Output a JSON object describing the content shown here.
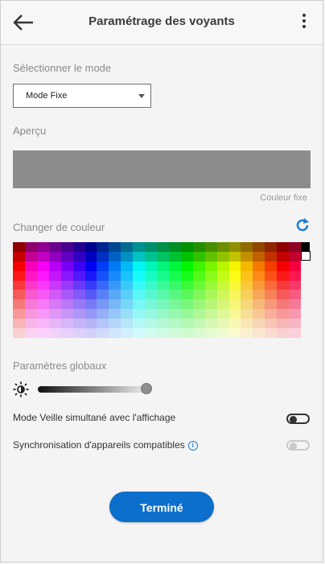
{
  "header": {
    "title": "Paramétrage des voyants",
    "back_icon": "arrow-left-icon",
    "menu_icon": "more-vertical-icon"
  },
  "mode": {
    "label": "Sélectionner le mode",
    "selected": "Mode Fixe"
  },
  "preview": {
    "label": "Aperçu",
    "color": "#8c8c8c",
    "caption": "Couleur fixe"
  },
  "color": {
    "label": "Changer de couleur",
    "reset_icon": "refresh-icon",
    "extra_swatches": [
      "#000000",
      "#ffffff"
    ]
  },
  "global": {
    "label": "Paramètres globaux",
    "brightness_icon": "brightness-icon",
    "brightness_value": 1.0,
    "sleep_label": "Mode Veille simultané avec l'affichage",
    "sleep_toggle": "off",
    "sync_label": "Synchronisation d'appareils compatibles",
    "sync_toggle": "off-disabled",
    "info_icon": "info-icon"
  },
  "footer": {
    "done_label": "Terminé",
    "accent": "#0c6fcb"
  }
}
